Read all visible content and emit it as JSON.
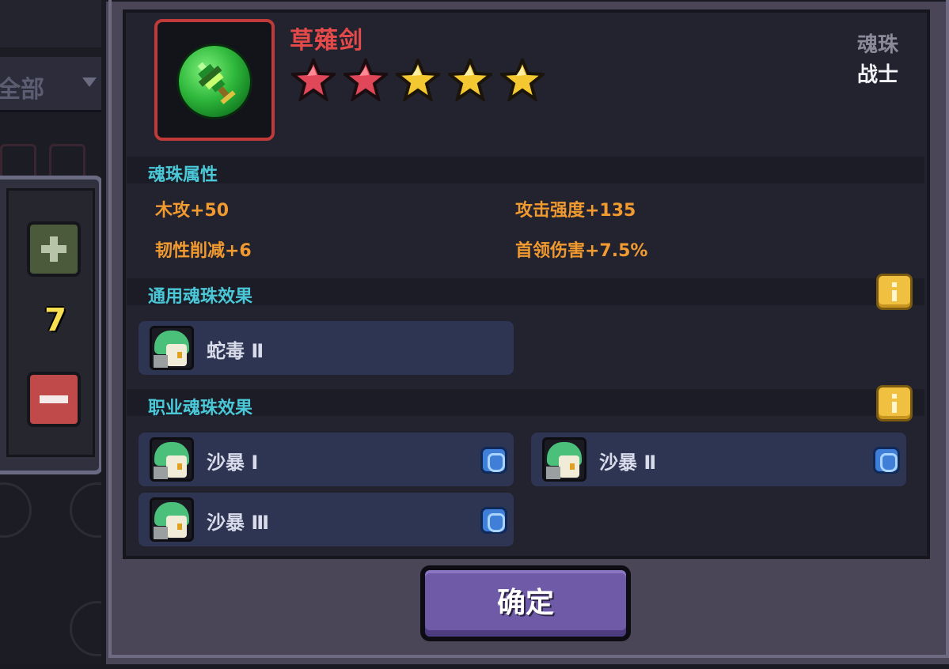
{
  "background": {
    "filter_label": "全部",
    "stepper_count": "7"
  },
  "item": {
    "name": "草薙剑",
    "stars": [
      {
        "color": "red"
      },
      {
        "color": "red"
      },
      {
        "color": "gold"
      },
      {
        "color": "gold"
      },
      {
        "color": "gold"
      }
    ],
    "category": "魂珠",
    "class": "战士",
    "icon": "green-orb-sword-icon"
  },
  "attributes": {
    "title": "魂珠属性",
    "items": [
      "木攻+50",
      "攻击强度+135",
      "韧性削减+6",
      "首领伤害+7.5%"
    ]
  },
  "general_effects": {
    "title": "通用魂珠效果",
    "cards": [
      {
        "label": "蛇毒 Ⅱ"
      }
    ]
  },
  "class_effects": {
    "title": "职业魂珠效果",
    "cards": [
      {
        "label": "沙暴 Ⅰ"
      },
      {
        "label": "沙暴 Ⅱ"
      },
      {
        "label": "沙暴 Ⅲ"
      }
    ]
  },
  "confirm_label": "确定",
  "colors": {
    "name": "#e44a4a",
    "section_title": "#4ac8d8",
    "attribute": "#f09a30",
    "confirm_bg": "#6f5aa8"
  }
}
